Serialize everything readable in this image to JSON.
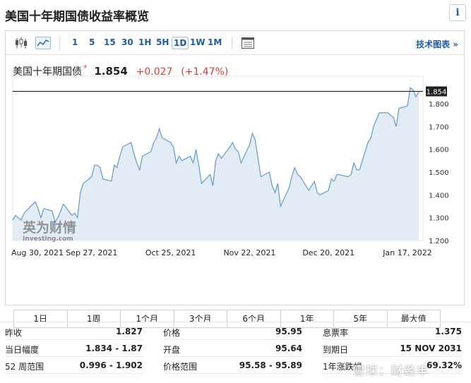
{
  "header": {
    "title": "美国十年期国债收益率概览",
    "info_icon": "i"
  },
  "toolbar": {
    "icons": [
      "candlestick-icon",
      "area-chart-icon",
      "calendar-icon"
    ],
    "periods": [
      "1",
      "5",
      "15",
      "30",
      "1H",
      "5H",
      "1D",
      "1W",
      "1M"
    ],
    "active_period": "1D",
    "tech_chart_label": "技术图表 »"
  },
  "quote": {
    "name": "美国十年期国债",
    "star": "*",
    "last": "1.854",
    "change": "+0.027",
    "change_pct": "(+1.47%)"
  },
  "watermark": {
    "brand": "英为财情",
    "site": "Investing.com",
    "social": "雪球：财经丰"
  },
  "chart_data": {
    "type": "area",
    "x_tick_labels": [
      "Aug 30, 2021",
      "Sep 27, 2021",
      "Oct 25, 2021",
      "Nov 22, 2021",
      "Dec 20, 2021",
      "Jan 17, 2022"
    ],
    "y_ticks": [
      "1.200",
      "1.300",
      "1.400",
      "1.500",
      "1.600",
      "1.700",
      "1.800"
    ],
    "ylim": [
      1.2,
      1.854
    ],
    "x_start": "2021-08-30",
    "x_end": "2022-01-21",
    "current_value": 1.854,
    "current_label": "1.854",
    "series": [
      {
        "values": [
          [
            "2021-08-30",
            1.29
          ],
          [
            "2021-08-31",
            1.31
          ],
          [
            "2021-09-01",
            1.3
          ],
          [
            "2021-09-02",
            1.29
          ],
          [
            "2021-09-03",
            1.32
          ],
          [
            "2021-09-07",
            1.37
          ],
          [
            "2021-09-08",
            1.34
          ],
          [
            "2021-09-09",
            1.3
          ],
          [
            "2021-09-10",
            1.34
          ],
          [
            "2021-09-13",
            1.33
          ],
          [
            "2021-09-14",
            1.28
          ],
          [
            "2021-09-15",
            1.3
          ],
          [
            "2021-09-16",
            1.33
          ],
          [
            "2021-09-17",
            1.36
          ],
          [
            "2021-09-20",
            1.31
          ],
          [
            "2021-09-21",
            1.32
          ],
          [
            "2021-09-22",
            1.3
          ],
          [
            "2021-09-23",
            1.41
          ],
          [
            "2021-09-24",
            1.45
          ],
          [
            "2021-09-27",
            1.48
          ],
          [
            "2021-09-28",
            1.53
          ],
          [
            "2021-09-29",
            1.53
          ],
          [
            "2021-09-30",
            1.52
          ],
          [
            "2021-10-01",
            1.47
          ],
          [
            "2021-10-04",
            1.46
          ],
          [
            "2021-10-05",
            1.53
          ],
          [
            "2021-10-06",
            1.52
          ],
          [
            "2021-10-07",
            1.57
          ],
          [
            "2021-10-08",
            1.61
          ],
          [
            "2021-10-11",
            1.63
          ],
          [
            "2021-10-12",
            1.58
          ],
          [
            "2021-10-13",
            1.54
          ],
          [
            "2021-10-14",
            1.51
          ],
          [
            "2021-10-15",
            1.57
          ],
          [
            "2021-10-18",
            1.59
          ],
          [
            "2021-10-19",
            1.63
          ],
          [
            "2021-10-20",
            1.65
          ],
          [
            "2021-10-21",
            1.69
          ],
          [
            "2021-10-22",
            1.65
          ],
          [
            "2021-10-25",
            1.63
          ],
          [
            "2021-10-26",
            1.61
          ],
          [
            "2021-10-27",
            1.54
          ],
          [
            "2021-10-28",
            1.57
          ],
          [
            "2021-10-29",
            1.55
          ],
          [
            "2021-11-01",
            1.57
          ],
          [
            "2021-11-02",
            1.54
          ],
          [
            "2021-11-03",
            1.6
          ],
          [
            "2021-11-04",
            1.53
          ],
          [
            "2021-11-05",
            1.45
          ],
          [
            "2021-11-08",
            1.49
          ],
          [
            "2021-11-09",
            1.44
          ],
          [
            "2021-11-10",
            1.55
          ],
          [
            "2021-11-11",
            1.58
          ],
          [
            "2021-11-12",
            1.56
          ],
          [
            "2021-11-15",
            1.61
          ],
          [
            "2021-11-16",
            1.63
          ],
          [
            "2021-11-17",
            1.6
          ],
          [
            "2021-11-18",
            1.59
          ],
          [
            "2021-11-19",
            1.54
          ],
          [
            "2021-11-22",
            1.62
          ],
          [
            "2021-11-23",
            1.67
          ],
          [
            "2021-11-24",
            1.64
          ],
          [
            "2021-11-26",
            1.48
          ],
          [
            "2021-11-29",
            1.5
          ],
          [
            "2021-11-30",
            1.44
          ],
          [
            "2021-12-01",
            1.41
          ],
          [
            "2021-12-02",
            1.45
          ],
          [
            "2021-12-03",
            1.35
          ],
          [
            "2021-12-06",
            1.43
          ],
          [
            "2021-12-07",
            1.48
          ],
          [
            "2021-12-08",
            1.52
          ],
          [
            "2021-12-09",
            1.49
          ],
          [
            "2021-12-10",
            1.48
          ],
          [
            "2021-12-13",
            1.42
          ],
          [
            "2021-12-14",
            1.44
          ],
          [
            "2021-12-15",
            1.46
          ],
          [
            "2021-12-16",
            1.41
          ],
          [
            "2021-12-17",
            1.4
          ],
          [
            "2021-12-20",
            1.42
          ],
          [
            "2021-12-21",
            1.47
          ],
          [
            "2021-12-22",
            1.46
          ],
          [
            "2021-12-23",
            1.49
          ],
          [
            "2021-12-27",
            1.48
          ],
          [
            "2021-12-28",
            1.49
          ],
          [
            "2021-12-29",
            1.54
          ],
          [
            "2021-12-30",
            1.51
          ],
          [
            "2021-12-31",
            1.51
          ],
          [
            "2022-01-03",
            1.63
          ],
          [
            "2022-01-04",
            1.65
          ],
          [
            "2022-01-05",
            1.7
          ],
          [
            "2022-01-06",
            1.73
          ],
          [
            "2022-01-07",
            1.76
          ],
          [
            "2022-01-10",
            1.76
          ],
          [
            "2022-01-11",
            1.75
          ],
          [
            "2022-01-12",
            1.74
          ],
          [
            "2022-01-13",
            1.7
          ],
          [
            "2022-01-14",
            1.78
          ],
          [
            "2022-01-17",
            1.79
          ],
          [
            "2022-01-18",
            1.87
          ],
          [
            "2022-01-19",
            1.86
          ],
          [
            "2022-01-20",
            1.83
          ],
          [
            "2022-01-21",
            1.854
          ]
        ]
      }
    ],
    "grid": false,
    "legend": "none"
  },
  "range_buttons": [
    "1日",
    "1周",
    "1个月",
    "3个月",
    "6个月",
    "1年",
    "5年",
    "最大值"
  ],
  "stats": [
    [
      {
        "label": "昨收",
        "value": "1.827"
      },
      {
        "label": "价格",
        "value": "95.95"
      },
      {
        "label": "息票率",
        "value": "1.375"
      }
    ],
    [
      {
        "label": "当日幅度",
        "value": "1.834 - 1.87"
      },
      {
        "label": "开盘",
        "value": "95.64"
      },
      {
        "label": "到期日",
        "value": "15 NOV 2031"
      }
    ],
    [
      {
        "label": "52 周范围",
        "value": "0.996 - 1.902"
      },
      {
        "label": "价格范围",
        "value": "95.58 - 95.89"
      },
      {
        "label": "1年涨跌幅",
        "value": "69.32%"
      }
    ]
  ],
  "colors": {
    "line": "#5b9bd5",
    "fill": "#e3ecf5",
    "accent_blue": "#1a5dab",
    "up_red": "#e03c31",
    "price_tag_bg": "#222222"
  }
}
